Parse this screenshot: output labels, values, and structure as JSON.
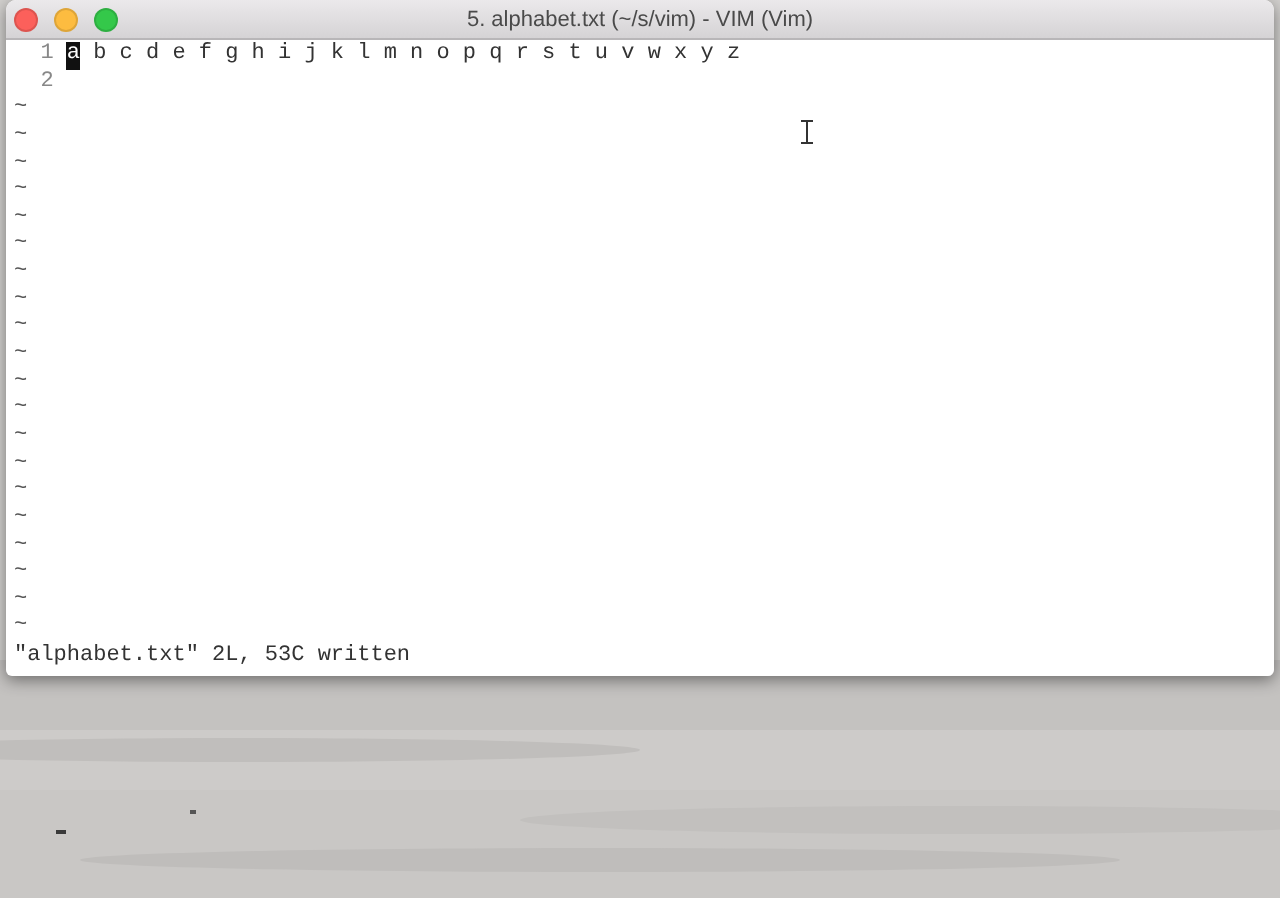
{
  "window": {
    "title": "5. alphabet.txt (~/s/vim) - VIM (Vim)"
  },
  "editor": {
    "lines": [
      {
        "number": "1",
        "segments": [
          {
            "text": "a",
            "cursor": true
          },
          {
            "text": "b c d e f g h i j k l m n o p q r s t u v w x y z",
            "cursor": false
          }
        ]
      },
      {
        "number": "2"
      }
    ],
    "empty_lines": [
      "~",
      "~",
      "~",
      "~",
      "~",
      "~",
      "~",
      "~",
      "~",
      "~",
      "~",
      "~",
      "~",
      "~",
      "~",
      "~",
      "~",
      "~",
      "~",
      "~"
    ],
    "status": "\"alphabet.txt\" 2L, 53C written"
  }
}
